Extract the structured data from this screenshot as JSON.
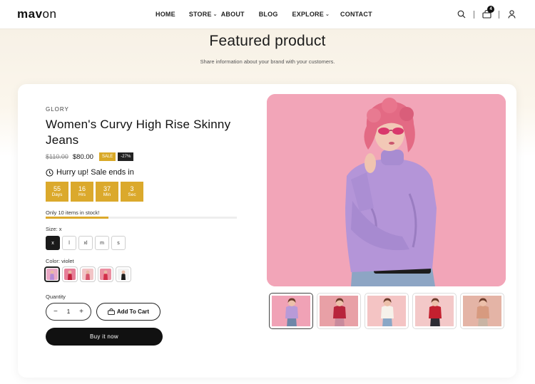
{
  "brand": {
    "logo_bold": "mav",
    "logo_thin": "on"
  },
  "nav": {
    "items": [
      {
        "label": "HOME",
        "dropdown": false
      },
      {
        "label": "STORE",
        "dropdown": true
      },
      {
        "label": "ABOUT",
        "dropdown": false
      },
      {
        "label": "BLOG",
        "dropdown": false
      },
      {
        "label": "EXPLORE",
        "dropdown": true
      },
      {
        "label": "CONTACT",
        "dropdown": false
      }
    ]
  },
  "header_icons": {
    "search": "search-icon",
    "cart": "cart-icon",
    "account": "user-icon",
    "cart_count": "4"
  },
  "section": {
    "title": "Featured product",
    "subtitle": "Share information about your brand with your customers."
  },
  "product": {
    "vendor": "GLORY",
    "title": "Women's Curvy High Rise Skinny Jeans",
    "compare_price": "$110.00",
    "price": "$80.00",
    "sale_badge": "SALE",
    "discount_badge": "-27%",
    "hurry_text": "Hurry up! Sale ends in",
    "countdown": [
      {
        "value": "55",
        "unit": "Days"
      },
      {
        "value": "16",
        "unit": "Hrs"
      },
      {
        "value": "37",
        "unit": "Min"
      },
      {
        "value": "3",
        "unit": "Sec"
      }
    ],
    "stock_text": "Only 10 items in stock!",
    "stock_fraction": 0.33,
    "size_label": "Size:",
    "size_selected": "x",
    "sizes": [
      "x",
      "l",
      "xl",
      "m",
      "s"
    ],
    "color_label": "Color:",
    "color_selected": "violet",
    "swatches": [
      {
        "name": "violet",
        "bg": "#e9a8c5",
        "fg": "#b58ad6"
      },
      {
        "name": "red",
        "bg": "#e67f98",
        "fg": "#c0203b"
      },
      {
        "name": "pink",
        "bg": "#f2c4c6",
        "fg": "#d6556b"
      },
      {
        "name": "rose",
        "bg": "#eb8fa1",
        "fg": "#d23049"
      },
      {
        "name": "black",
        "bg": "#f3f3f3",
        "fg": "#1b1b1b"
      }
    ],
    "quantity_label": "Quantity",
    "quantity": "1",
    "minus": "−",
    "plus": "+",
    "add_to_cart": "Add To Cart",
    "buy_now": "Buy it now"
  },
  "gallery": {
    "main_bg": "#f2a5b8",
    "thumbs": [
      {
        "bg": "#f0a2b6",
        "top": "#b89ad8",
        "bottom": "#6f86a8",
        "active": true
      },
      {
        "bg": "#e8a0a6",
        "top": "#b8243c",
        "bottom": "#c98a9c",
        "active": false
      },
      {
        "bg": "#f4c4c4",
        "top": "#f6f1ea",
        "bottom": "#8aa7c6",
        "active": false
      },
      {
        "bg": "#f3c8c8",
        "top": "#c3202f",
        "bottom": "#2c2c34",
        "active": false
      },
      {
        "bg": "#e4b4a6",
        "top": "#d79a7f",
        "bottom": "#c9b4a4",
        "active": false
      }
    ]
  },
  "colors": {
    "accent": "#dba92c",
    "dark": "#111111"
  }
}
